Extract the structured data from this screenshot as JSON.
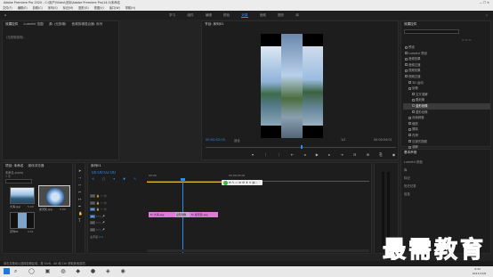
{
  "titlebar": {
    "title": "Adobe Premiere Pro 2020 - C:\\用户\\Video\\无标\\Adobe Premiere Pro\\14.0\\未命名"
  },
  "menubar": {
    "items": [
      "文件(F)",
      "编辑(E)",
      "剪辑(C)",
      "序列(S)",
      "标记(M)",
      "图形(G)",
      "视图(V)",
      "窗口(W)",
      "帮助(H)"
    ]
  },
  "workspaces": {
    "items": [
      "学习",
      "组件",
      "编辑",
      "颜色",
      "效果",
      "音频",
      "图形",
      "库"
    ],
    "active": "效果"
  },
  "source_panel": {
    "tabs": [
      "效果控件",
      "Lumetri 范围",
      "源: (无剪辑)",
      "音频剪辑混合器: 序列"
    ],
    "label": "(无剪辑选择)"
  },
  "program_monitor": {
    "title": "节目: 序列01",
    "timecode": "00:00:02:00",
    "fit": "适合",
    "ratio": "1/2",
    "duration": "00:00:04:01"
  },
  "effects_panel": {
    "title": "效果控件",
    "search_placeholder": "",
    "items": [
      "预设",
      "Lumetri 预设",
      "音频效果",
      "音频过渡",
      "视频效果",
      "视频过渡",
      "3D 运动",
      "划像",
      "交叉溶解",
      "圆划像",
      "盒形划像",
      "菱形划像",
      "页面剥落",
      "缩放",
      "擦除",
      "内滑",
      "沉浸式视频",
      "溶解",
      "数据驱动"
    ],
    "highlighted": "盒形划像"
  },
  "lower_right": {
    "title": "基本声音",
    "items": [
      "Lumetri 颜色",
      "库",
      "标记",
      "历史记录",
      "信息"
    ]
  },
  "project_panel": {
    "tabs": [
      "项目: 未命名",
      "媒体浏览器"
    ],
    "name": "未命名.prproj",
    "count": "3 项",
    "clips": [
      {
        "name": "大海.jpg",
        "dur": "5:00"
      },
      {
        "name": "摩天轮.jpg",
        "dur": "5:00"
      },
      {
        "name": "序列01",
        "dur": "4:01"
      }
    ]
  },
  "timeline": {
    "tab": "序列01",
    "timecode": "00:00:02:00",
    "ruler": [
      "00:00",
      "00:00:05:00"
    ],
    "tracks": [
      "V3",
      "V2",
      "V1",
      "A1",
      "A2",
      "A3"
    ],
    "master": "主声道",
    "master_val": "0.0",
    "clip1": "大海.jpg",
    "clip2": "摩天轮.jpg",
    "transition": "盒形划像"
  },
  "status_bar": {
    "text": "单击并拖动以选择剪辑区域。按 Shift、Alt 和 Ctrl 获取其他选项。"
  },
  "watermark": {
    "text": "最需教育"
  },
  "taskbar": {
    "time": "9:32",
    "date": "2021/11/8"
  }
}
